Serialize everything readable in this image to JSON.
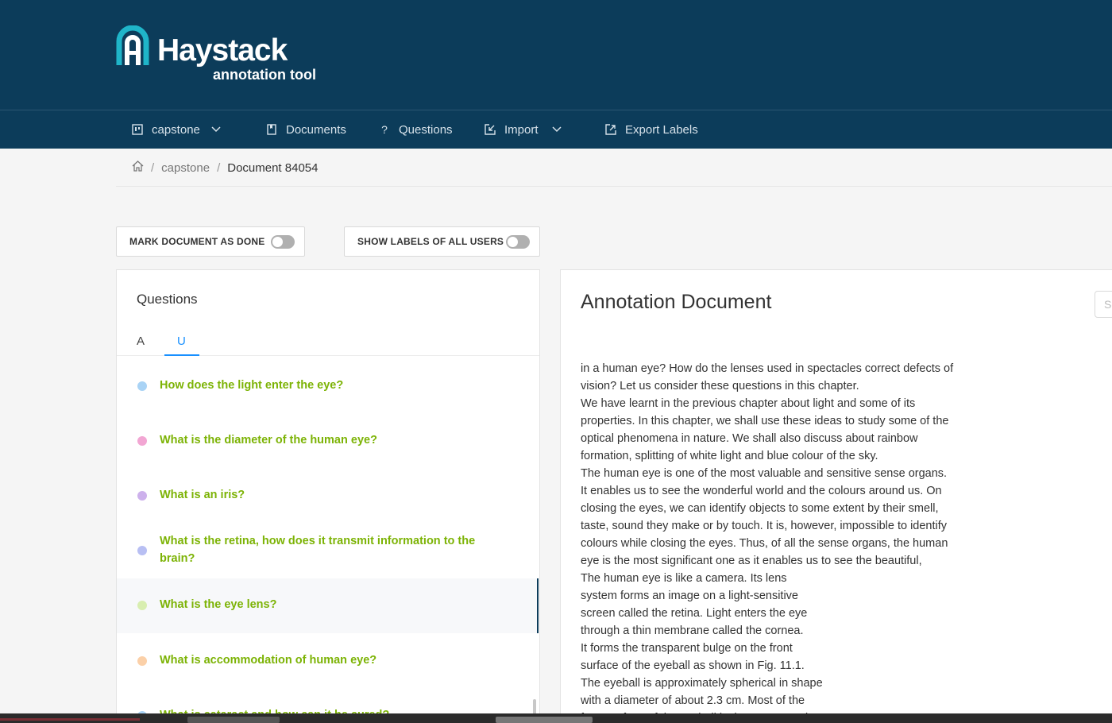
{
  "brand": {
    "title": "Haystack",
    "subtitle": "annotation tool",
    "colors": {
      "header_bg": "#0c3c5a",
      "accent": "#1890ff",
      "question_text": "#7cb305"
    }
  },
  "nav": {
    "items": [
      {
        "label": "capstone",
        "icon": "project-icon",
        "dropdown": true
      },
      {
        "label": "Documents",
        "icon": "document-icon",
        "dropdown": false
      },
      {
        "label": "Questions",
        "icon": "question-icon",
        "dropdown": false
      },
      {
        "label": "Import",
        "icon": "import-icon",
        "dropdown": true
      },
      {
        "label": "Export Labels",
        "icon": "export-icon",
        "dropdown": false
      }
    ]
  },
  "breadcrumb": {
    "home_icon": "home-icon",
    "project": "capstone",
    "separator": "/",
    "current": "Document 84054"
  },
  "toggles": {
    "mark_done": {
      "label": "MARK DOCUMENT AS DONE",
      "on": false
    },
    "show_labels": {
      "label": "SHOW LABELS OF ALL USERS",
      "on": false
    }
  },
  "questions_panel": {
    "title": "Questions",
    "tabs": [
      {
        "label": "A",
        "active": false
      },
      {
        "label": "U",
        "active": true
      }
    ],
    "items": [
      {
        "text": "How does the light enter the eye?",
        "dot_color": "#a9d3f5"
      },
      {
        "text": "What is the diameter of the human eye?",
        "dot_color": "#f2a6d3"
      },
      {
        "text": "What is an iris?",
        "dot_color": "#cdb1ec"
      },
      {
        "text": "What is the retina, how does it transmit information to the brain?",
        "dot_color": "#b8bff3"
      },
      {
        "text": "What is the eye lens?",
        "dot_color": "#d8eeb0"
      },
      {
        "text": "What is accommodation of human eye?",
        "dot_color": "#fbd0a8"
      },
      {
        "text": "What is cataract and how can it be cured?",
        "dot_color": "#a9d3f5"
      }
    ]
  },
  "document": {
    "title": "Annotation Document",
    "search_placeholder": "Se",
    "lines": [
      "in a human eye? How do the lenses used in spectacles correct defects of",
      "vision? Let us consider these questions in this chapter.",
      "We have learnt in the previous chapter about light and some of its",
      "properties. In this chapter, we shall use these ideas to study some of the",
      "optical phenomena in nature. We shall also discuss about rainbow",
      "formation, splitting of white light and blue colour of the sky.",
      "The human eye is one of the most valuable and sensitive sense organs.",
      "It enables us to see the wonderful world and the colours around us. On",
      "closing the eyes, we can identify objects to some extent by their smell,",
      "taste, sound they make or by touch. It is, however, impossible to identify",
      "colours while closing the eyes. Thus, of all the sense organs, the human",
      "eye is the most significant one as it enables us to see the beautiful,",
      "The human eye is like a camera. Its lens",
      "system forms an image on a light-sensitive",
      "screen called the retina. Light enters the eye",
      "through a thin membrane called the cornea.",
      "It forms the transparent bulge on the front",
      "surface of the eyeball as shown in Fig. 11.1.",
      "The eyeball is approximately spherical in shape",
      "with a diameter of about 2.3 cm. Most of the",
      "front surface of the eyeball is the cornea and"
    ]
  }
}
